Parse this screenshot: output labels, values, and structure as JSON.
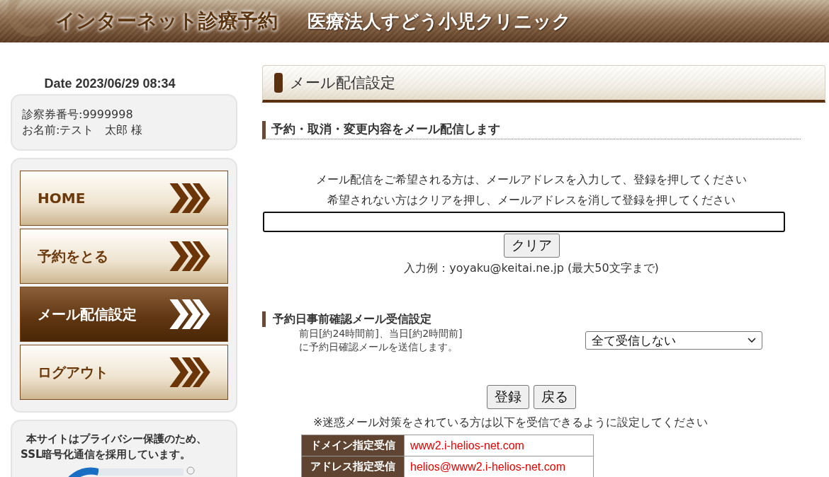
{
  "header": {
    "service_title": "インターネット診療予約",
    "clinic_name": "医療法人すどう小児クリニック"
  },
  "sidebar": {
    "date": "Date 2023/06/29 08:34",
    "patient": {
      "card_number": "診察券番号:9999998",
      "name": "お名前:テスト　太郎 様"
    },
    "nav": [
      {
        "label": "HOME",
        "selected": false
      },
      {
        "label": "予約をとる",
        "selected": false
      },
      {
        "label": "メール配信設定",
        "selected": true
      },
      {
        "label": "ログアウト",
        "selected": false
      }
    ],
    "privacy_note": "本サイトはプライバシー保護のため、SSL暗号化通信を採用しています。"
  },
  "main": {
    "page_title": "メール配信設定",
    "section_1": {
      "heading": "予約・取消・変更内容をメール配信します",
      "instructions": [
        "メール配信をご希望される方は、メールアドレスを入力して、登録を押してください",
        "希望されない方はクリアを押し、メールアドレスを消して登録を押してください"
      ],
      "clear_button": "クリア",
      "example": "入力例：yoyaku@keitai.ne.jp (最大50文字まで)"
    },
    "section_2": {
      "heading": "予約日事前確認メール受信設定",
      "description": [
        "前日[約24時間前]、当日[約2時間前]",
        "に予約日確認メールを送信します。"
      ],
      "select_value": "全て受信しない"
    },
    "buttons": [
      "登録",
      "戻る"
    ],
    "spam_note": "※迷惑メール対策をされている方は以下を受信できるように設定してください",
    "receive_table": [
      {
        "label": "ドメイン指定受信",
        "value": "www2.i-helios-net.com"
      },
      {
        "label": "アドレス指定受信",
        "value": "helios@www2.i-helios-net.com"
      }
    ]
  }
}
